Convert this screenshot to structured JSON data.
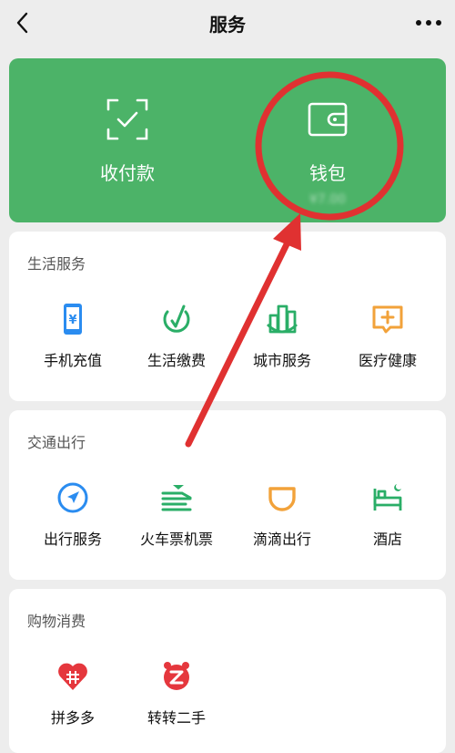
{
  "header": {
    "title": "服务"
  },
  "wallet_card": {
    "pay_label": "收付款",
    "wallet_label": "钱包",
    "wallet_amount": "¥7.00"
  },
  "sections": [
    {
      "title": "生活服务",
      "items": [
        {
          "label": "手机充值",
          "icon": "phone-recharge-icon"
        },
        {
          "label": "生活缴费",
          "icon": "utility-payment-icon"
        },
        {
          "label": "城市服务",
          "icon": "city-service-icon"
        },
        {
          "label": "医疗健康",
          "icon": "medical-health-icon"
        }
      ]
    },
    {
      "title": "交通出行",
      "items": [
        {
          "label": "出行服务",
          "icon": "travel-service-icon"
        },
        {
          "label": "火车票机票",
          "icon": "train-plane-ticket-icon"
        },
        {
          "label": "滴滴出行",
          "icon": "didi-icon"
        },
        {
          "label": "酒店",
          "icon": "hotel-icon"
        }
      ]
    },
    {
      "title": "购物消费",
      "items": [
        {
          "label": "拼多多",
          "icon": "pinduoduo-icon"
        },
        {
          "label": "转转二手",
          "icon": "zhuanzhuan-icon"
        }
      ]
    }
  ],
  "colors": {
    "wallet_green": "#4cb368",
    "icon_blue": "#2a8cf0",
    "icon_green": "#2aae67",
    "icon_orange": "#f2a23a",
    "annotation_red": "#e03131"
  }
}
